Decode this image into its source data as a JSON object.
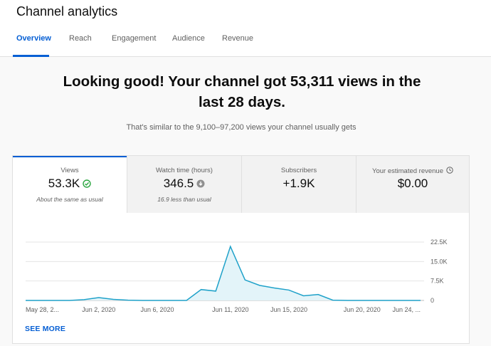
{
  "header": {
    "title": "Channel analytics",
    "tabs": [
      {
        "label": "Overview",
        "active": true
      },
      {
        "label": "Reach",
        "active": false
      },
      {
        "label": "Engagement",
        "active": false
      },
      {
        "label": "Audience",
        "active": false
      },
      {
        "label": "Revenue",
        "active": false
      }
    ]
  },
  "summary": {
    "headline_line1": "Looking good! Your channel got 53,311 views in the",
    "headline_line2": "last 28 days.",
    "subtext": "That's similar to the 9,100–97,200 views your channel usually gets"
  },
  "metrics": [
    {
      "label": "Views",
      "value": "53.3K",
      "note": "About the same as usual",
      "icon": "check-circle-icon",
      "active": true
    },
    {
      "label": "Watch time (hours)",
      "value": "346.5",
      "note": "16.9 less than usual",
      "icon": "down-arrow-circle-icon",
      "active": false
    },
    {
      "label": "Subscribers",
      "value": "+1.9K",
      "note": "",
      "icon": "",
      "active": false
    },
    {
      "label": "Your estimated revenue",
      "value": "$0.00",
      "note": "",
      "icon": "clock-icon",
      "active": false
    }
  ],
  "see_more_label": "SEE MORE",
  "colors": {
    "accent": "#065fd4",
    "chart_line": "#1ea1c9",
    "chart_fill": "#e3f4f9",
    "good": "#2ba640"
  },
  "chart_data": {
    "type": "area",
    "series_label": "Views",
    "y_ticks": [
      "22.5K",
      "15.0K",
      "7.5K",
      "0"
    ],
    "ylim": [
      0,
      22500
    ],
    "x_labels": [
      "May 28, 2...",
      "Jun 2, 2020",
      "Jun 6, 2020",
      "Jun 11, 2020",
      "Jun 15, 2020",
      "Jun 20, 2020",
      "Jun 24, ..."
    ],
    "x_label_days": [
      0,
      5,
      9,
      14,
      18,
      23,
      27
    ],
    "x": [
      0,
      1,
      2,
      3,
      4,
      5,
      6,
      7,
      8,
      9,
      10,
      11,
      12,
      13,
      14,
      15,
      16,
      17,
      18,
      19,
      20,
      21,
      22,
      23,
      24,
      25,
      26,
      27
    ],
    "values": [
      0,
      0,
      0,
      0,
      300,
      1100,
      400,
      100,
      0,
      0,
      0,
      0,
      4200,
      3600,
      20800,
      7900,
      5800,
      4800,
      4000,
      1800,
      2300,
      100,
      0,
      0,
      0,
      0,
      0,
      0
    ]
  }
}
